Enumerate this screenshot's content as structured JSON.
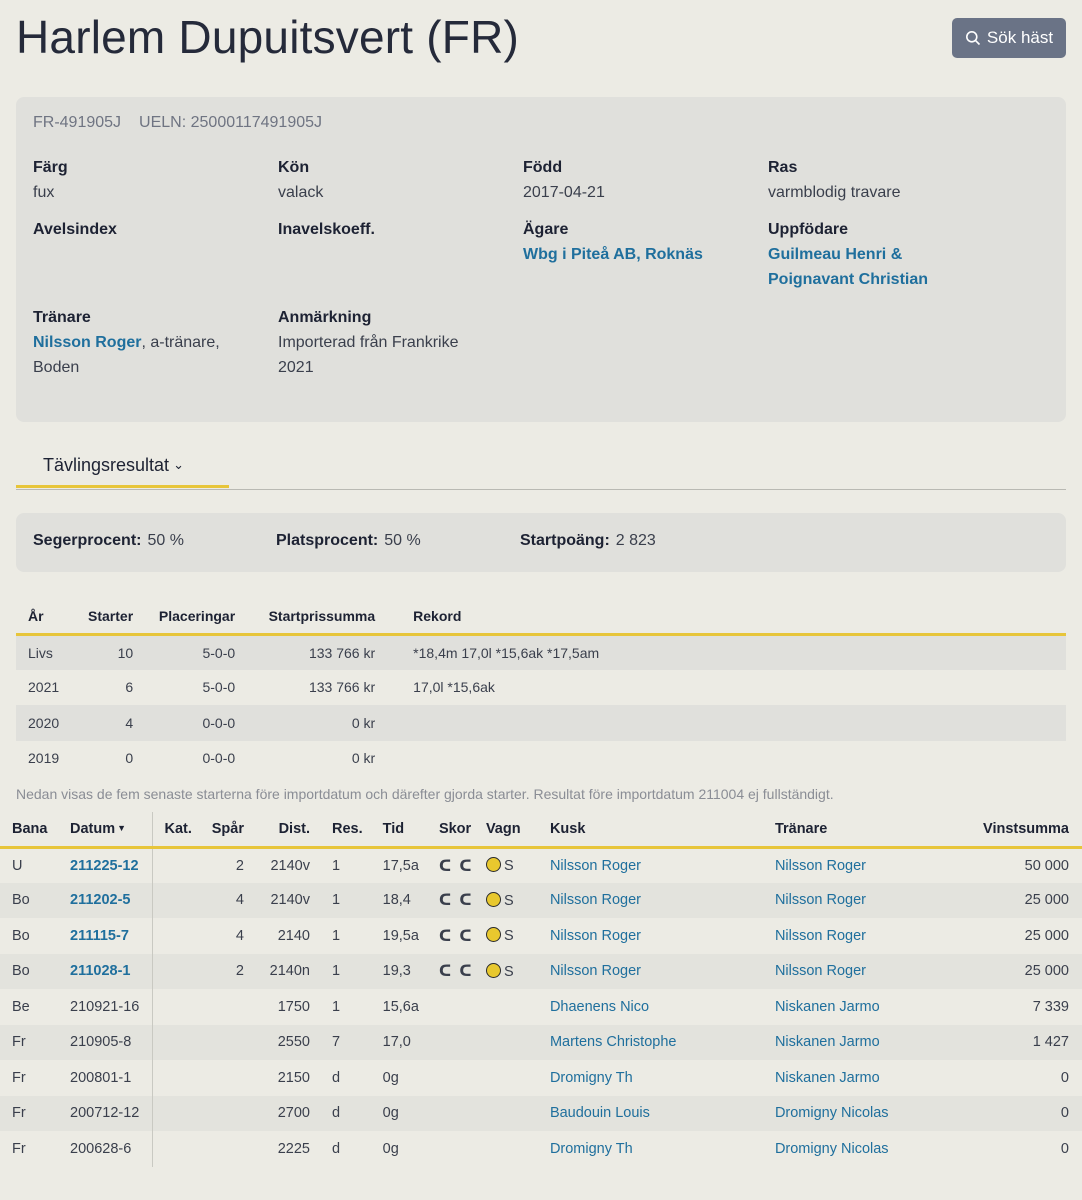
{
  "horse": {
    "name": "Harlem Dupuitsvert (FR)",
    "reg_id": "FR-491905J",
    "ueln": "UELN: 25000117491905J"
  },
  "search_button": {
    "label": "Sök häst",
    "icon": "search-icon"
  },
  "info": {
    "farg": {
      "label": "Färg",
      "value": "fux"
    },
    "kon": {
      "label": "Kön",
      "value": "valack"
    },
    "fodd": {
      "label": "Född",
      "value": "2017-04-21"
    },
    "ras": {
      "label": "Ras",
      "value": "varmblodig travare"
    },
    "avelsindex": {
      "label": "Avelsindex",
      "value": ""
    },
    "inavel": {
      "label": "Inavelskoeff.",
      "value": ""
    },
    "agare": {
      "label": "Ägare",
      "value": "Wbg i Piteå AB, Roknäs"
    },
    "uppfodare": {
      "label": "Uppfödare",
      "value": "Guilmeau Henri & Poignavant Christian"
    },
    "tranare": {
      "label": "Tränare",
      "name": "Nilsson Roger",
      "suffix": ", a-tränare, Boden"
    },
    "anmarkning": {
      "label": "Anmärkning",
      "value": "Importerad från Frankrike 2021"
    }
  },
  "tab": {
    "label": "Tävlingsresultat",
    "icon": "chevron-down-icon"
  },
  "stats": {
    "seger": {
      "label": "Segerprocent:",
      "value": "50 %"
    },
    "plats": {
      "label": "Platsprocent:",
      "value": "50 %"
    },
    "startpoang": {
      "label": "Startpoäng:",
      "value": "2 823"
    }
  },
  "summary": {
    "headers": [
      "År",
      "Starter",
      "Placeringar",
      "Startprissumma",
      "Rekord"
    ],
    "rows": [
      [
        "Livs",
        "10",
        "5-0-0",
        "133 766 kr",
        "*18,4m 17,0l *15,6ak *17,5am"
      ],
      [
        "2021",
        "6",
        "5-0-0",
        "133 766 kr",
        "17,0l *15,6ak"
      ],
      [
        "2020",
        "4",
        "0-0-0",
        "0 kr",
        ""
      ],
      [
        "2019",
        "0",
        "0-0-0",
        "0 kr",
        ""
      ]
    ]
  },
  "note": "Nedan visas de fem senaste starterna före importdatum och därefter gjorda starter. Resultat före importdatum 211004 ej fullständigt.",
  "races": {
    "headers": [
      "Bana",
      "Datum",
      "Kat.",
      "Spår",
      "Dist.",
      "Res.",
      "Tid",
      "Skor",
      "Vagn",
      "Kusk",
      "Tränare",
      "Vinstsumma"
    ],
    "rows": [
      {
        "bana": "U",
        "datum": "211225-12",
        "link": true,
        "kat": "",
        "spar": "2",
        "dist": "2140v",
        "res": "1",
        "tid": "17,5a",
        "skor": "ᑕ ᑕ",
        "vagn": "S",
        "kusk": "Nilsson Roger",
        "tranare": "Nilsson Roger",
        "vinst": "50 000"
      },
      {
        "bana": "Bo",
        "datum": "211202-5",
        "link": true,
        "kat": "",
        "spar": "4",
        "dist": "2140v",
        "res": "1",
        "tid": "18,4",
        "skor": "ᑕ ᑕ",
        "vagn": "S",
        "kusk": "Nilsson Roger",
        "tranare": "Nilsson Roger",
        "vinst": "25 000"
      },
      {
        "bana": "Bo",
        "datum": "211115-7",
        "link": true,
        "kat": "",
        "spar": "4",
        "dist": "2140",
        "res": "1",
        "tid": "19,5a",
        "skor": "ᑕ ᑕ",
        "vagn": "S",
        "kusk": "Nilsson Roger",
        "tranare": "Nilsson Roger",
        "vinst": "25 000"
      },
      {
        "bana": "Bo",
        "datum": "211028-1",
        "link": true,
        "kat": "",
        "spar": "2",
        "dist": "2140n",
        "res": "1",
        "tid": "19,3",
        "skor": "ᑕ ᑕ",
        "vagn": "S",
        "kusk": "Nilsson Roger",
        "tranare": "Nilsson Roger",
        "vinst": "25 000"
      },
      {
        "bana": "Be",
        "datum": "210921-16",
        "link": false,
        "kat": "",
        "spar": "",
        "dist": "1750",
        "res": "1",
        "tid": "15,6a",
        "skor": "",
        "vagn": "",
        "kusk": "Dhaenens Nico",
        "tranare": "Niskanen Jarmo",
        "vinst": "7 339"
      },
      {
        "bana": "Fr",
        "datum": "210905-8",
        "link": false,
        "kat": "",
        "spar": "",
        "dist": "2550",
        "res": "7",
        "tid": "17,0",
        "skor": "",
        "vagn": "",
        "kusk": "Martens Christophe",
        "tranare": "Niskanen Jarmo",
        "vinst": "1 427"
      },
      {
        "bana": "Fr",
        "datum": "200801-1",
        "link": false,
        "kat": "",
        "spar": "",
        "dist": "2150",
        "res": "d",
        "tid": "0g",
        "skor": "",
        "vagn": "",
        "kusk": "Dromigny Th",
        "tranare": "Niskanen Jarmo",
        "vinst": "0"
      },
      {
        "bana": "Fr",
        "datum": "200712-12",
        "link": false,
        "kat": "",
        "spar": "",
        "dist": "2700",
        "res": "d",
        "tid": "0g",
        "skor": "",
        "vagn": "",
        "kusk": "Baudouin Louis",
        "tranare": "Dromigny Nicolas",
        "vinst": "0"
      },
      {
        "bana": "Fr",
        "datum": "200628-6",
        "link": false,
        "kat": "",
        "spar": "",
        "dist": "2225",
        "res": "d",
        "tid": "0g",
        "skor": "",
        "vagn": "",
        "kusk": "Dromigny Th",
        "tranare": "Dromigny Nicolas",
        "vinst": "0"
      }
    ]
  },
  "colors": {
    "accent": "#e7c53a",
    "link": "#1f6f9d",
    "button": "#6a7386",
    "background": "#ecebe4",
    "card": "#e0e0dc"
  }
}
